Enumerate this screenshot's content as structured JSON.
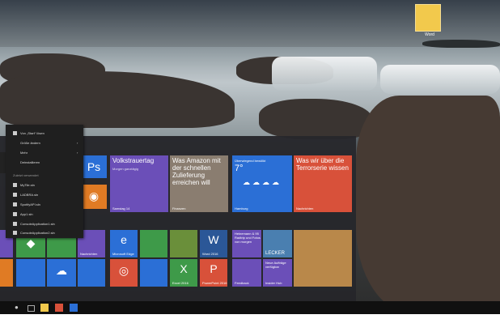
{
  "desktop": {
    "icon_label": "Word"
  },
  "context_menu": {
    "items": [
      "Von „Start“ lösen",
      "Größe ändern",
      "Mehr",
      "Deinstallieren"
    ],
    "section": "Zuletzt verwendet",
    "recent": [
      "MyTile.sln",
      "LADBRA.sln",
      "SpotifyAPI.sln",
      "App1.sln",
      "ConsoleApplication1.sln",
      "ConsoleApplication2.sln"
    ]
  },
  "tiles": {
    "volkstrauertag": "Volkstrauertag",
    "volks_sub": "Morgen ganztägig",
    "volks_date": "Samstag 14",
    "amazon": "Was Amazon mit der schnellen Zulieferung erreichen will",
    "amazon_sub": "Finanzen",
    "weather_small": "Überwiegend bewölkt",
    "weather_temp": "7°",
    "weather_city": "Hamburg",
    "news": "Was wir über die Terrorserie wissen",
    "news_sub": "Nachrichten",
    "nachrichten": "Nachrichten",
    "edge": "Microsoft Edge",
    "word": "Word 2016",
    "excel": "Excel 2016",
    "ppt": "PowerPoint 2016",
    "hotmail": "Heinemann & 95 Radtrip und Fotos von morgen",
    "lecker": "LECKER",
    "lecker_sub": "Neue Aufträge verfügbar",
    "insider": "Insider Hub",
    "feedback": "Feedback",
    "ps": "Ps"
  },
  "colors": {
    "accent": "#2b6fd6",
    "purple": "#6b4fb8",
    "red": "#d8513a",
    "orange": "#e07b24",
    "green": "#3e9a49"
  }
}
